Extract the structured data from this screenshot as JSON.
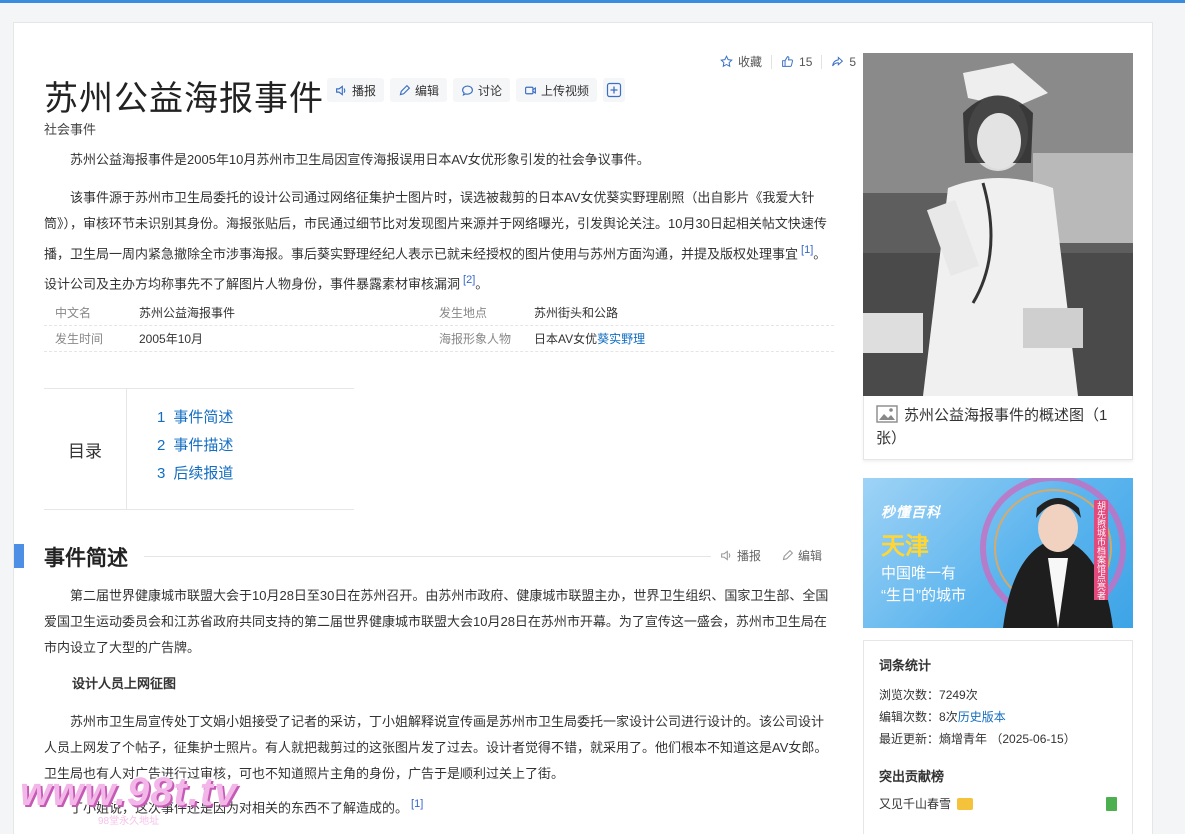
{
  "title": "苏州公益海报事件",
  "subtitle": "社会事件",
  "actions": [
    {
      "label": "播报",
      "icon": "speaker-icon"
    },
    {
      "label": "编辑",
      "icon": "pencil-icon"
    },
    {
      "label": "讨论",
      "icon": "chat-icon"
    },
    {
      "label": "上传视频",
      "icon": "video-icon"
    }
  ],
  "meta": {
    "favorite": "收藏",
    "likes": "15",
    "shares": "5"
  },
  "summary": "苏州公益海报事件是2005年10月苏州市卫生局因宣传海报误用日本AV女优形象引发的社会争议事件。",
  "para2": {
    "text1": "该事件源于苏州市卫生局委托的设计公司通过网络征集护士图片时，误选被裁剪的日本AV女优葵实野理剧照（出自影片《我爱大针筒》），审核环节未识别其身份。海报张贴后，市民通过细节比对发现图片来源并于网络曝光，引发舆论关注。10月30日起相关帖文快速传播，卫生局一周内紧急撤除全市涉事海报。事后葵实野理经纪人表示已就未经授权的图片使用与苏州方面沟通，并提及版权处理事宜",
    "ref1": "[1]",
    "text2": "。设计公司及主办方均称事先不了解图片人物身份，事件暴露素材审核漏洞",
    "ref2": "[2]",
    "text3": "。"
  },
  "info": {
    "name_k": "中文名",
    "name_v": "苏州公益海报事件",
    "place_k": "发生地点",
    "place_v": "苏州街头和公路",
    "time_k": "发生时间",
    "time_v": "2005年10月",
    "person_k": "海报形象人物",
    "person_prefix": "日本AV女优",
    "person_link": "葵实野理"
  },
  "toc": {
    "label": "目录",
    "items": [
      {
        "num": "1",
        "label": "事件简述"
      },
      {
        "num": "2",
        "label": "事件描述"
      },
      {
        "num": "3",
        "label": "后续报道"
      }
    ]
  },
  "section": {
    "title": "事件简述",
    "play": "播报",
    "edit": "编辑"
  },
  "sec_p1": "第二届世界健康城市联盟大会于10月28日至30日在苏州召开。由苏州市政府、健康城市联盟主办，世界卫生组织、国家卫生部、全国爱国卫生运动委员会和江苏省政府共同支持的第二届世界健康城市联盟大会10月28日在苏州市开幕。为了宣传这一盛会，苏州市卫生局在市内设立了大型的广告牌。",
  "sec_h": "设计人员上网征图",
  "sec_p2": "苏州市卫生局宣传处丁文娟小姐接受了记者的采访，丁小姐解释说宣传画是苏州市卫生局委托一家设计公司进行设计的。该公司设计人员上网发了个帖子，征集护士照片。有人就把裁剪过的这张图片发了过去。设计者觉得不错，就采用了。他们根本不知道这是AV女郎。卫生局也有人对广告进行过审核，可也不知道照片主角的身份，广告于是顺利过关上了街。",
  "sec_p3": {
    "text": "丁小姐说，这次事件还是因为对相关的东西不了解造成的。",
    "ref": "[1]"
  },
  "photo_caption": "苏州公益海报事件的概述图（1张）",
  "ad": {
    "brand": "秒懂百科",
    "city": "天津",
    "line1": "中国唯一有",
    "line2": "“生日”的城市",
    "tag": "胡先煦城市档案馆点亮者"
  },
  "stats": {
    "title": "词条统计",
    "views_label": "浏览次数：",
    "views": "7249次",
    "edits_label": "编辑次数：",
    "edits": "8次",
    "history": "历史版本",
    "updated_label": "最近更新：",
    "updated": "熵增青年 （2025-06-15）",
    "contrib_title": "突出贡献榜",
    "contributor": "又见千山春雪"
  },
  "watermark": {
    "big": "www.98t.tv",
    "small": "98堂永久地址"
  },
  "colors": {
    "accent": "#3a8dde",
    "link": "#136ec2",
    "section_bar": "#4e8fe6"
  }
}
